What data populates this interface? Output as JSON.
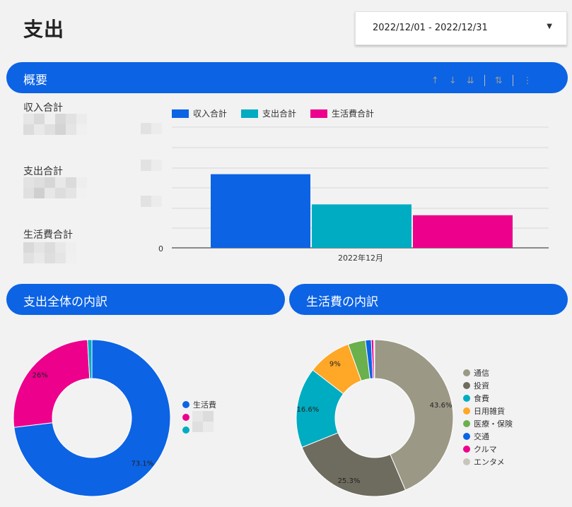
{
  "page": {
    "title": "支出"
  },
  "date_range": {
    "value": "2022/12/01 - 2022/12/31"
  },
  "overview": {
    "title": "概要",
    "metrics": [
      {
        "label": "収入合計"
      },
      {
        "label": "支出合計"
      },
      {
        "label": "生活費合計"
      }
    ]
  },
  "expense_breakdown": {
    "title": "支出全体の内訳"
  },
  "living_breakdown": {
    "title": "生活費の内訳"
  },
  "colors": {
    "blue": "#0c63e4",
    "teal": "#00acc1",
    "pink": "#ec008c",
    "gray": "#9c9886",
    "dark_gray": "#6e6b5f",
    "orange": "#ffa726",
    "green": "#6ab04c",
    "light_gray": "#c8c6bc"
  },
  "chart_data": [
    {
      "type": "bar",
      "categories": [
        "2022年12月"
      ],
      "series": [
        {
          "name": "収入合計",
          "values": [
            0.61
          ]
        },
        {
          "name": "支出合計",
          "values": [
            0.36
          ]
        },
        {
          "name": "生活費合計",
          "values": [
            0.27
          ]
        }
      ],
      "yticks": [
        "0"
      ],
      "ylim": [
        0,
        1
      ],
      "grid": true,
      "legend": "top-left"
    },
    {
      "type": "pie",
      "labels": [
        "生活費",
        "",
        ""
      ],
      "values": [
        73.1,
        26,
        0.9
      ],
      "data_labels": [
        "73.1%",
        "26%",
        ""
      ],
      "legend": "right"
    },
    {
      "type": "pie",
      "labels": [
        "通信",
        "投資",
        "食費",
        "日用雑貨",
        "医療・保険",
        "交通",
        "クルマ",
        "エンタメ"
      ],
      "values": [
        43.6,
        25.3,
        16.6,
        9,
        3.6,
        1.2,
        0.5,
        0.2
      ],
      "data_labels": [
        "43.6%",
        "25.3%",
        "16.6%",
        "9%",
        "",
        "",
        "",
        ""
      ],
      "legend": "right"
    }
  ]
}
